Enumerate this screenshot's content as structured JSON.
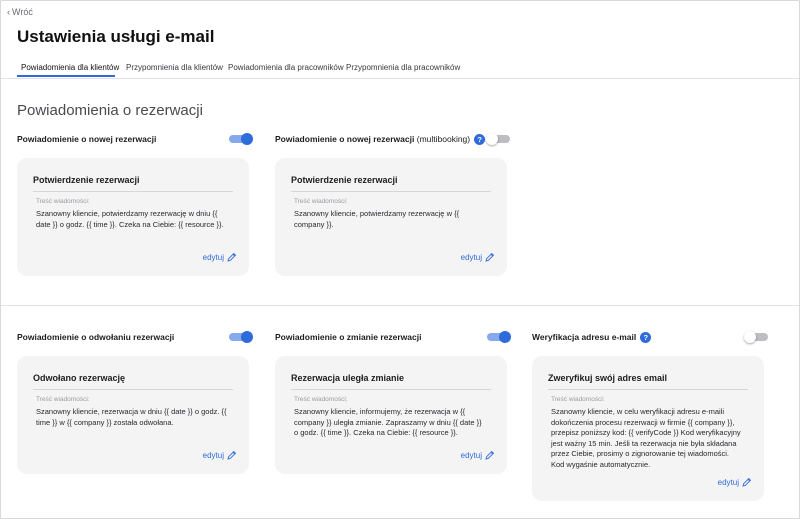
{
  "nav": {
    "back_label": "Wróć"
  },
  "page": {
    "title": "Ustawienia usługi e-mail"
  },
  "tabs": [
    {
      "label": "Powiadomienia dla klientów",
      "active": true
    },
    {
      "label": "Przypomnienia dla klientów",
      "active": false
    },
    {
      "label": "Powiadomienia dla pracowników",
      "active": false
    },
    {
      "label": "Przypomnienia dla pracowników",
      "active": false
    }
  ],
  "section": {
    "title": "Powiadomienia o rezerwacji"
  },
  "accent_color": "#2f6bdb",
  "field_label": "Treść wiadomości:",
  "edit_label": "edytuj",
  "notifications": [
    {
      "label": "Powiadomienie o nowej rezerwacji",
      "enabled": true,
      "card_title": "Potwierdzenie rezerwacji",
      "message": "Szanowny kliencie, potwierdzamy rezerwację w dniu {{ date }} o godz. {{ time }}. Czeka na Ciebie: {{ resource }}."
    },
    {
      "label": "Powiadomienie o nowej rezerwacji",
      "label_suffix": "(multibooking)",
      "enabled": false,
      "card_title": "Potwierdzenie rezerwacji",
      "message": "Szanowny kliencie, potwierdzamy rezerwację w {{ company }}."
    },
    {
      "label": "Powiadomienie o odwołaniu rezerwacji",
      "enabled": true,
      "card_title": "Odwołano rezerwację",
      "message": "Szanowny kliencie, rezerwacja w dniu {{ date }} o godz. {{ time }} w {{ company }} została odwołana."
    },
    {
      "label": "Powiadomienie o zmianie rezerwacji",
      "enabled": true,
      "card_title": "Rezerwacja uległa zmianie",
      "message": "Szanowny kliencie, informujemy, że rezerwacja w {{ company }} uległa zmianie. Zapraszamy w dniu {{ date }} o godz. {{ time }}. Czeka na Ciebie: {{ resource }}."
    },
    {
      "label": "Weryfikacja adresu e-mail",
      "enabled": false,
      "card_title": "Zweryfikuj swój adres email",
      "message": "Szanowny kliencie, w celu weryfikacji adresu e-maili dokończenia procesu rezerwacji w firmie {{ company }}, przepisz poniższy kod: {{ verifyCode }} Kod weryfikacyjny jest ważny 15 min. Jeśli ta rezerwacja nie była składana przez Ciebie, prosimy o zignorowanie tej wiadomości. Kod wygaśnie automatycznie."
    }
  ]
}
